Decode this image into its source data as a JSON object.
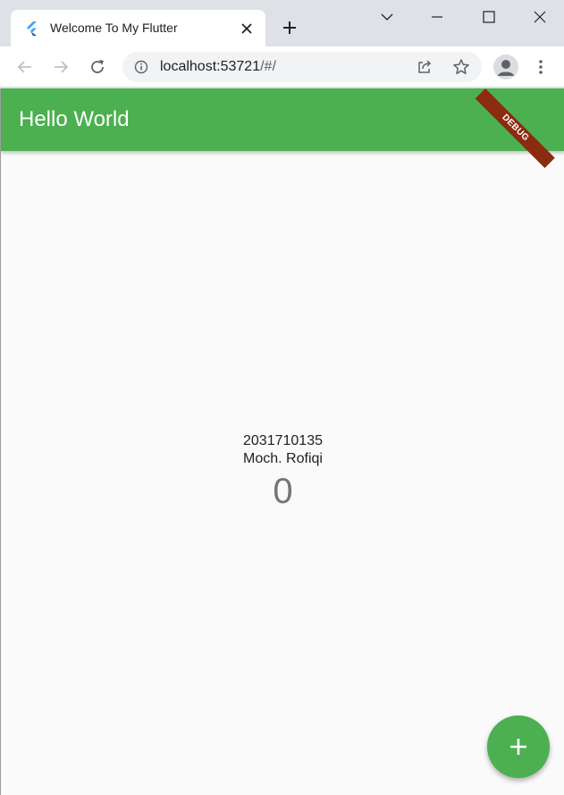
{
  "browser": {
    "tab": {
      "title": "Welcome To My Flutter",
      "favicon": "flutter-logo-icon"
    },
    "url": {
      "host": "localhost:53721",
      "path": "/#/"
    },
    "icons": {
      "close": "close-icon",
      "new_tab": "plus-icon",
      "tab_search": "chevron-down-icon",
      "minimize": "minimize-icon",
      "maximize": "maximize-icon",
      "close_window": "close-icon",
      "back": "back-arrow-icon",
      "forward": "forward-arrow-icon",
      "reload": "reload-icon",
      "info": "info-icon",
      "share": "share-icon",
      "bookmark": "star-icon",
      "profile": "profile-icon",
      "menu": "kebab-menu-icon"
    }
  },
  "app": {
    "appbar_title": "Hello World",
    "debug_banner": "DEBUG",
    "student_id": "2031710135",
    "student_name": "Moch. Rofiqi",
    "counter": "0",
    "fab_icon": "plus-icon",
    "colors": {
      "primary": "#4caf50",
      "banner": "#8b2b10",
      "background": "#fafafa"
    }
  }
}
